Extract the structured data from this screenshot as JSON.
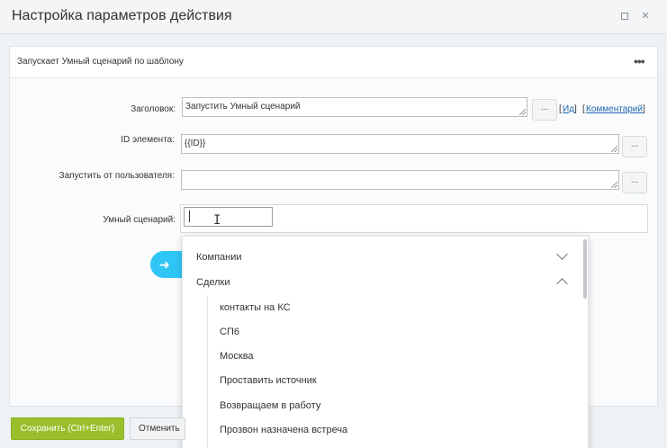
{
  "window": {
    "title": "Настройка параметров действия",
    "maximize_icon": "maximize-icon",
    "close_icon": "close-icon"
  },
  "panel": {
    "title": "Запускает Умный сценарий по шаблону",
    "more_icon": "more-dots-icon"
  },
  "fields": {
    "heading": {
      "label": "Заголовок:",
      "value": "Запустить Умный сценарий",
      "button": "...",
      "link_id": "Ид",
      "link_comment": "Комментарий"
    },
    "element_id": {
      "label": "ID элемента:",
      "value": "{{ID}}",
      "button": "..."
    },
    "run_as_user": {
      "label": "Запустить от пользователя:",
      "value": "",
      "button": "..."
    },
    "smart_scenario": {
      "label": "Умный сценарий:",
      "value": ""
    }
  },
  "dropdown": {
    "groups": [
      {
        "label": "Компании",
        "expanded": false
      },
      {
        "label": "Сделки",
        "expanded": true
      }
    ],
    "items": [
      "контакты на КС",
      "СП6",
      "Москва",
      "Проставить источник",
      "Возвращаем в работу",
      "Прозвон назначена встреча"
    ]
  },
  "footer": {
    "save_label": "Сохранить (Ctrl+Enter)",
    "cancel_label": "Отменить"
  },
  "colors": {
    "save": "#9bbf2c",
    "accent": "#2fc6f6",
    "link": "#2067b0"
  }
}
